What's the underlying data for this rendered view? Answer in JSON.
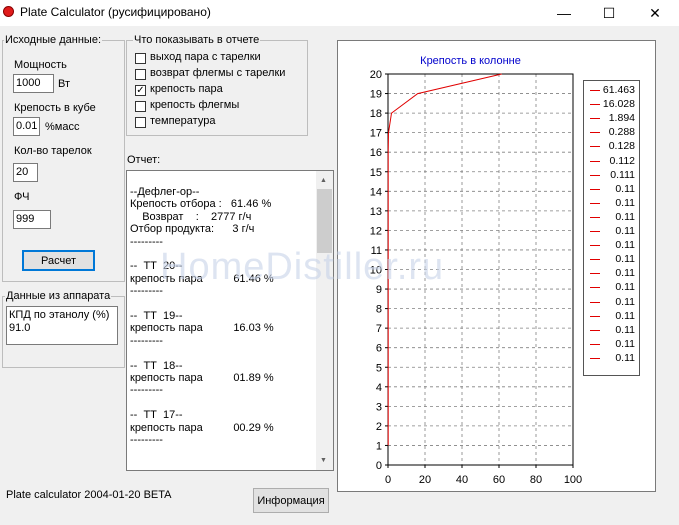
{
  "window": {
    "title": "Plate Calculator (русифицировано)",
    "minimize_glyph": "—",
    "maximize_glyph": "☐",
    "close_glyph": "✕"
  },
  "input_group": {
    "title": "Исходные данные:",
    "power_label": "Мощность",
    "power_value": "1000",
    "power_unit": "Вт",
    "cube_strength_label": "Крепость в кубе",
    "cube_strength_value": "0.01",
    "cube_strength_unit": "%масс",
    "plates_label": "Кол-во тарелок",
    "plates_value": "20",
    "fch_label": "ФЧ",
    "fch_value": "999",
    "calc_button": "Расчет"
  },
  "apparatus_group": {
    "title": "Данные из аппарата",
    "kpd_text": "КПД по этанолу (%)\n91.0"
  },
  "show_group": {
    "title": "Что показывать в отчете",
    "items": [
      {
        "label": "выход пара с тарелки",
        "checked": false
      },
      {
        "label": "возврат флегмы с тарелки",
        "checked": false
      },
      {
        "label": "крепость пара",
        "checked": true
      },
      {
        "label": "крепость флегмы",
        "checked": false
      },
      {
        "label": "температура",
        "checked": false
      }
    ]
  },
  "report": {
    "label": "Отчет:",
    "lines": [
      "--Дефлег-ор--",
      "Крепость отбора :   61.46 %",
      "    Возврат    :    2777 г/ч",
      "Отбор продукта:      3 г/ч",
      "---------",
      "",
      "--  ТТ  20--",
      "крепость пара          61.46 %",
      "---------",
      "",
      "--  ТТ  19--",
      "крепость пара          16.03 %",
      "---------",
      "",
      "--  ТТ  18--",
      "крепость пара          01.89 %",
      "---------",
      "",
      "--  ТТ  17--",
      "крепость пара          00.29 %",
      "---------"
    ]
  },
  "footer": {
    "version": "Plate calculator 2004-01-20 BETA",
    "info_button": "Информация"
  },
  "watermark": "HomeDistiller.ru",
  "colors": {
    "series": "#e00000",
    "chart_title": "#0000cc"
  },
  "chart_data": {
    "type": "line",
    "title": "Крепость в колонне",
    "xlim": [
      0,
      100
    ],
    "ylim": [
      0,
      20
    ],
    "x_ticks": [
      0,
      20,
      40,
      60,
      80,
      100
    ],
    "y_ticks": [
      0,
      1,
      2,
      3,
      4,
      5,
      6,
      7,
      8,
      9,
      10,
      11,
      12,
      13,
      14,
      15,
      16,
      17,
      18,
      19,
      20
    ],
    "grid": true,
    "legend_placement": "right",
    "legend_entries": [
      "61.463",
      "16.028",
      "1.894",
      "0.288",
      "0.128",
      "0.112",
      "0.111",
      "0.11",
      "0.11",
      "0.11",
      "0.11",
      "0.11",
      "0.11",
      "0.11",
      "0.11",
      "0.11",
      "0.11",
      "0.11",
      "0.11",
      "0.11"
    ],
    "series": [
      {
        "x": [
          0.11,
          0.11,
          0.11,
          0.11,
          0.11,
          0.11,
          0.11,
          0.11,
          0.11,
          0.11,
          0.11,
          0.11,
          0.11,
          0.111,
          0.112,
          0.128,
          0.288,
          1.894,
          16.028,
          61.463
        ],
        "y": [
          1,
          2,
          3,
          4,
          5,
          6,
          7,
          8,
          9,
          10,
          11,
          12,
          13,
          14,
          15,
          16,
          17,
          18,
          19,
          20
        ]
      }
    ]
  }
}
